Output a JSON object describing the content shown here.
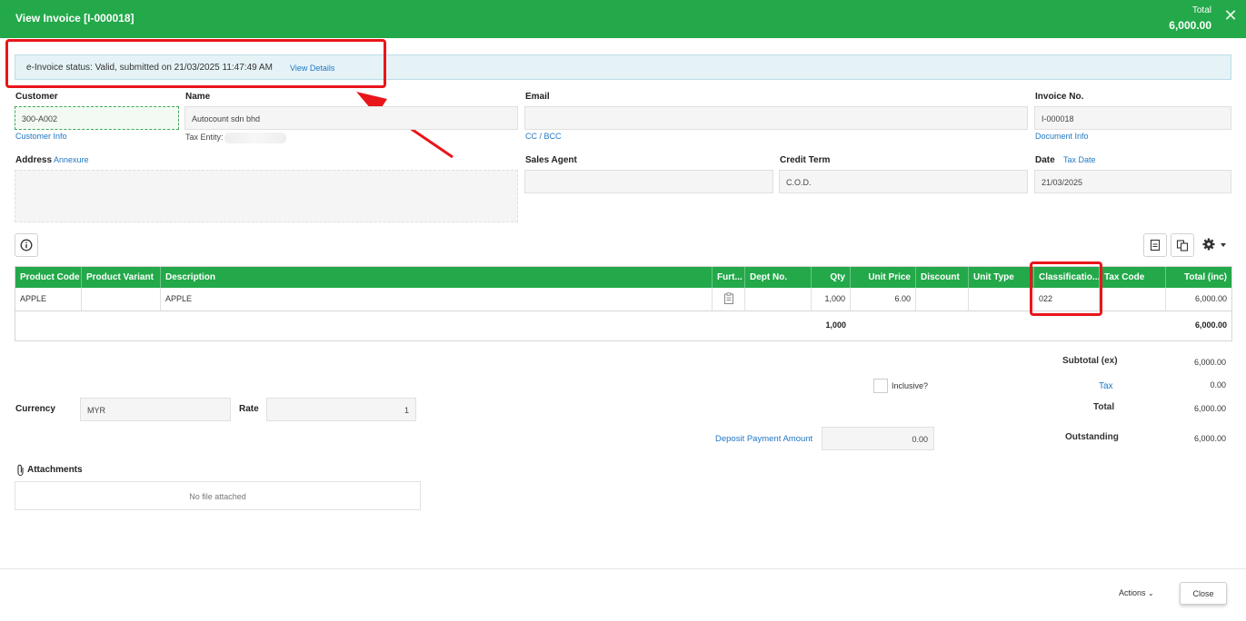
{
  "header": {
    "title": "View Invoice [I-000018]",
    "total_label": "Total",
    "total_value": "6,000.00",
    "color": "#23a94a"
  },
  "status": {
    "text": "e-Invoice status: Valid, submitted on 21/03/2025 11:47:49 AM",
    "link": "View Details"
  },
  "form": {
    "customer_label": "Customer",
    "customer_value": "300-A002",
    "customer_info": "Customer Info",
    "name_label": "Name",
    "name_value": "Autocount sdn bhd",
    "tax_entity_label": "Tax Entity:",
    "email_label": "Email",
    "email_value": "",
    "cc_bcc": "CC / BCC",
    "invoice_no_label": "Invoice No.",
    "invoice_no_value": "I-000018",
    "document_info": "Document Info",
    "address_label": "Address",
    "annexure": "Annexure",
    "address_value": "",
    "sales_agent_label": "Sales Agent",
    "sales_agent_value": "",
    "credit_term_label": "Credit Term",
    "credit_term_value": "C.O.D.",
    "date_label": "Date",
    "tax_date": "Tax Date",
    "date_value": "21/03/2025"
  },
  "grid": {
    "columns": [
      "Product Code",
      "Product Variant",
      "Description",
      "Furt...",
      "Dept No.",
      "Qty",
      "Unit Price",
      "Discount",
      "Unit Type",
      "Classificatio...",
      "Tax Code",
      "Total (inc)"
    ],
    "rows": [
      {
        "product_code": "APPLE",
        "product_variant": "",
        "description": "APPLE",
        "dept_no": "",
        "qty": "1,000",
        "unit_price": "6.00",
        "discount": "",
        "unit_type": "",
        "classification": "022",
        "tax_code": "",
        "total": "6,000.00"
      }
    ],
    "total_qty": "1,000",
    "total_amount": "6,000.00"
  },
  "summary": {
    "subtotal_label": "Subtotal (ex)",
    "subtotal_value": "6,000.00",
    "inclusive_label": "Inclusive?",
    "tax_label": "Tax",
    "tax_value": "0.00",
    "total_label": "Total",
    "total_value": "6,000.00",
    "outstanding_label": "Outstanding",
    "outstanding_value": "6,000.00",
    "deposit_label": "Deposit Payment Amount",
    "deposit_value": "0.00"
  },
  "currency": {
    "label": "Currency",
    "value": "MYR",
    "rate_label": "Rate",
    "rate_value": "1"
  },
  "attachments": {
    "label": "Attachments",
    "empty_text": "No file attached"
  },
  "footer": {
    "actions": "Actions",
    "close": "Close"
  },
  "icons": [
    "close-icon",
    "info-icon",
    "export-icon",
    "copy-icon",
    "gear-icon",
    "clipboard-icon",
    "paperclip-icon",
    "chevron-down-icon"
  ],
  "annotation_color": "#e8161b"
}
